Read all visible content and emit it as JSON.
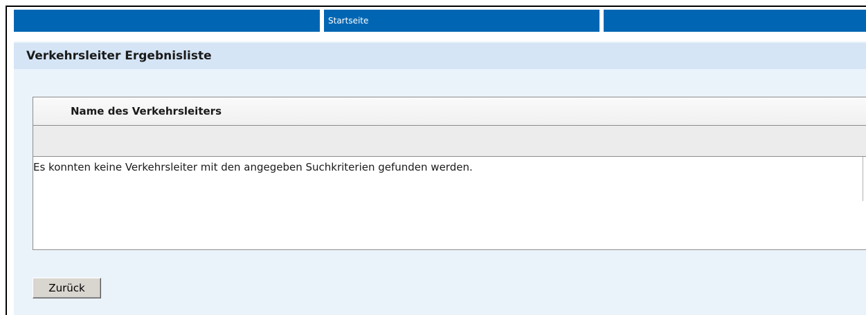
{
  "nav": {
    "segments": [
      "",
      "Startseite",
      ""
    ]
  },
  "page": {
    "title": "Verkehrsleiter Ergebnisliste"
  },
  "table": {
    "column_header": "Name des Verkehrsleiters",
    "empty_message": "Es konnten keine Verkehrsleiter mit den angegeben Suchkriterien gefunden werden."
  },
  "actions": {
    "back_label": "Zurück"
  },
  "colors": {
    "nav_blue": "#0066b3",
    "title_bar": "#d5e5f6",
    "content_bg": "#ebf3fa"
  }
}
